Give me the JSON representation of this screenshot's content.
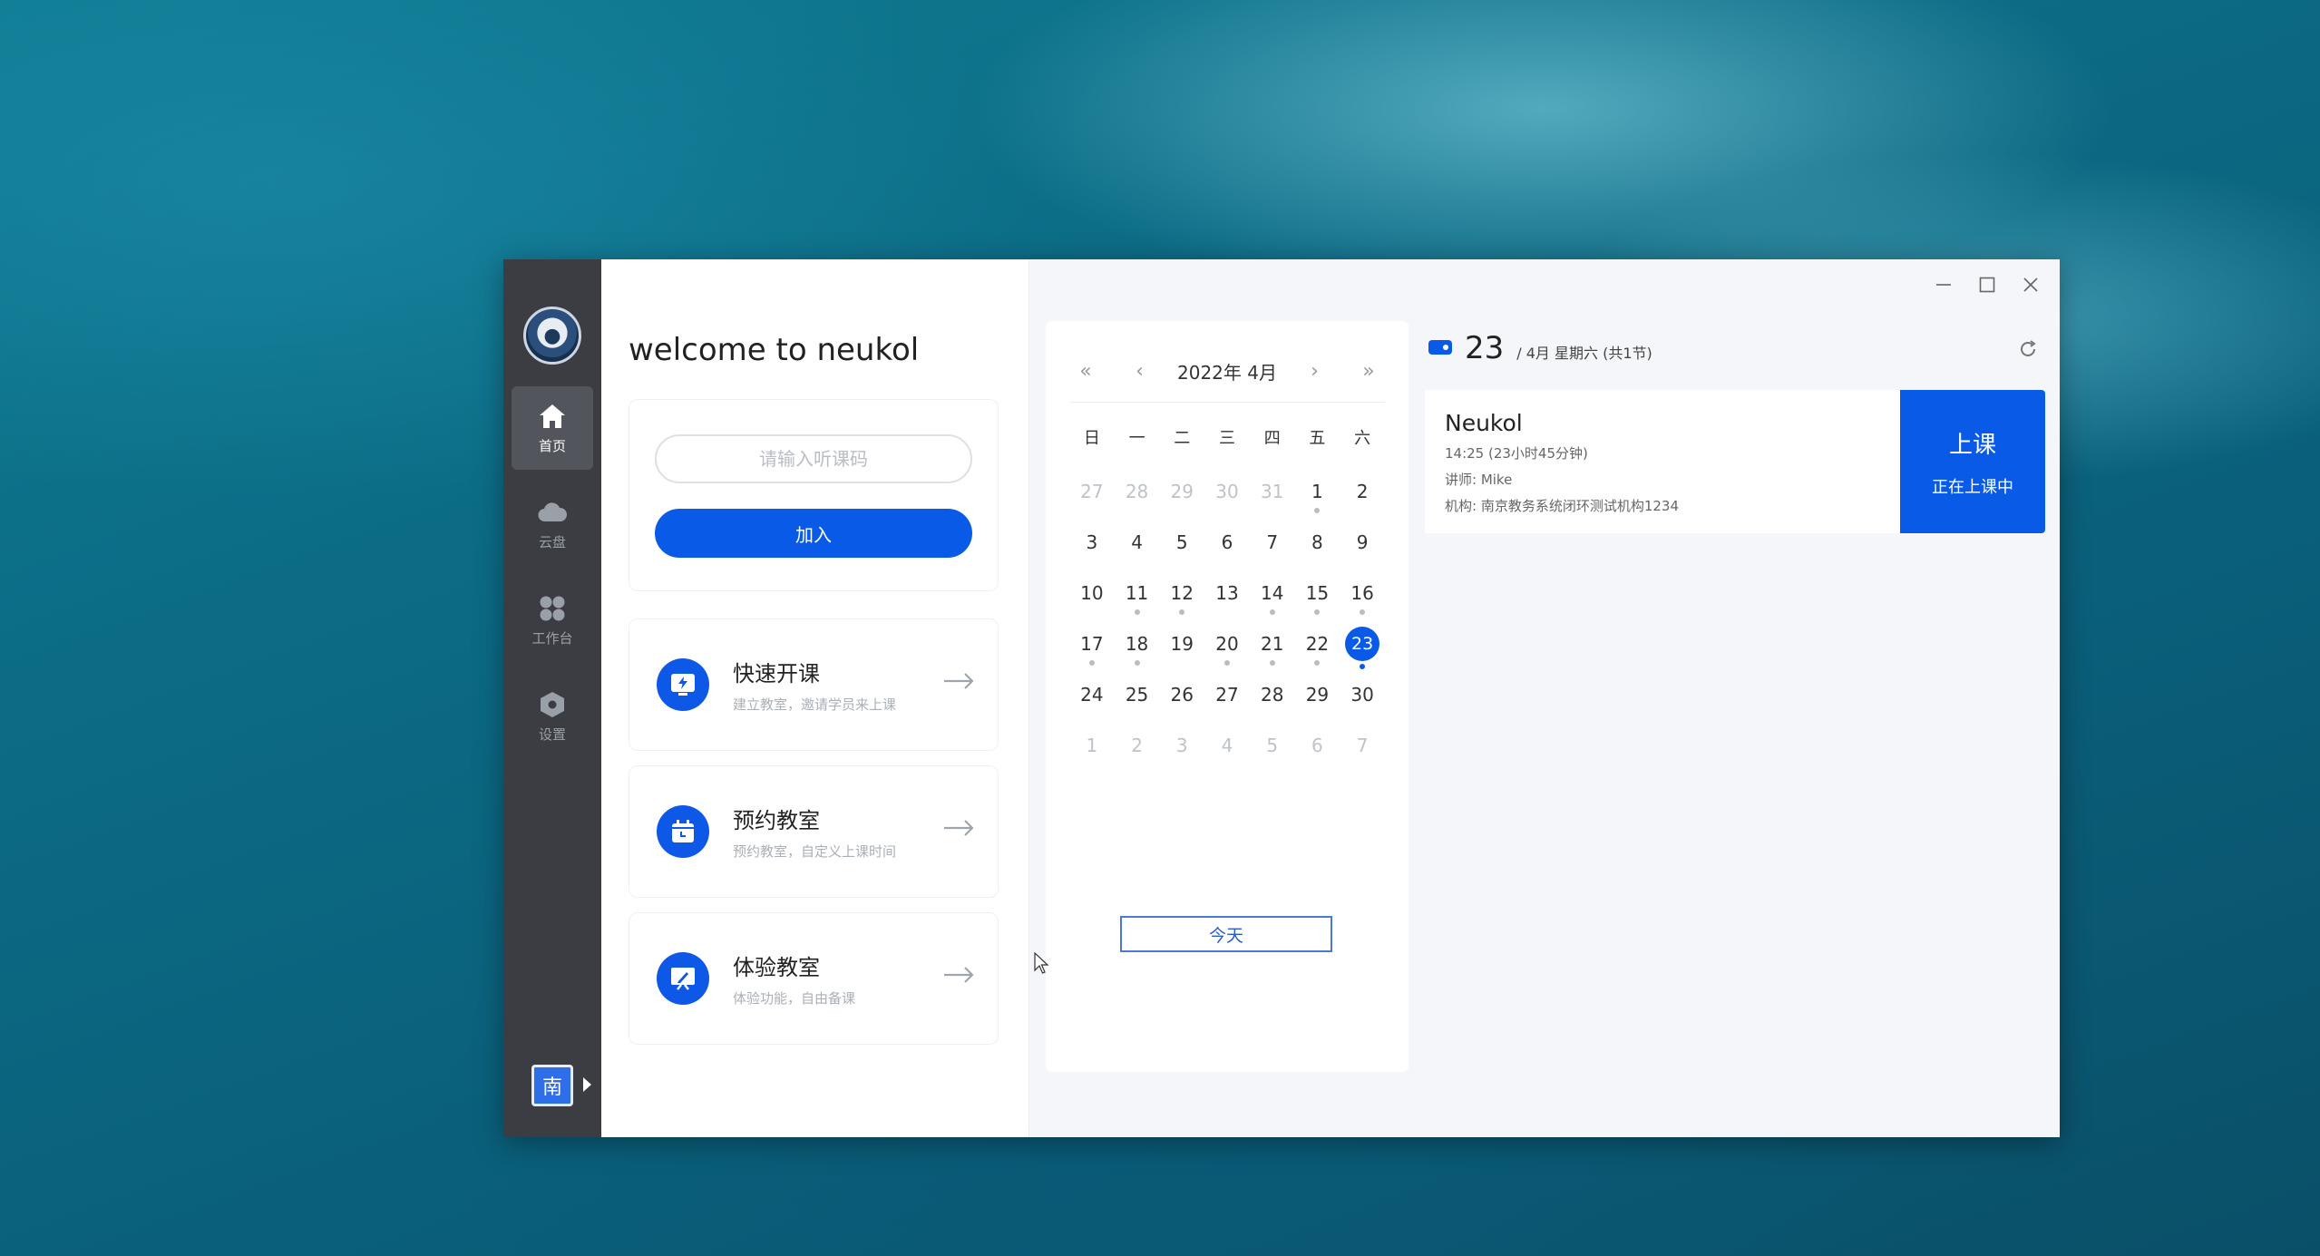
{
  "sidebar": {
    "items": [
      {
        "label": "首页",
        "icon": "home-icon",
        "active": true
      },
      {
        "label": "云盘",
        "icon": "cloud-icon",
        "active": false
      },
      {
        "label": "工作台",
        "icon": "workbench-icon",
        "active": false
      },
      {
        "label": "设置",
        "icon": "settings-icon",
        "active": false
      }
    ],
    "org_badge": "南"
  },
  "welcome": "welcome to neukol",
  "join": {
    "placeholder": "请输入听课码",
    "button": "加入"
  },
  "actions": [
    {
      "title": "快速开课",
      "subtitle": "建立教室，邀请学员来上课",
      "icon": "lightning-screen-icon"
    },
    {
      "title": "预约教室",
      "subtitle": "预约教室，自定义上课时间",
      "icon": "calendar-icon"
    },
    {
      "title": "体验教室",
      "subtitle": "体验功能，自由备课",
      "icon": "board-icon"
    }
  ],
  "calendar": {
    "prev_year": "«",
    "prev_month": "‹",
    "title": "2022年 4月",
    "next_month": "›",
    "next_year": "»",
    "weekdays": [
      "日",
      "一",
      "二",
      "三",
      "四",
      "五",
      "六"
    ],
    "weeks": [
      [
        {
          "d": "27",
          "o": true
        },
        {
          "d": "28",
          "o": true
        },
        {
          "d": "29",
          "o": true
        },
        {
          "d": "30",
          "o": true
        },
        {
          "d": "31",
          "o": true
        },
        {
          "d": "1",
          "dot": true
        },
        {
          "d": "2"
        }
      ],
      [
        {
          "d": "3"
        },
        {
          "d": "4"
        },
        {
          "d": "5"
        },
        {
          "d": "6"
        },
        {
          "d": "7"
        },
        {
          "d": "8"
        },
        {
          "d": "9"
        }
      ],
      [
        {
          "d": "10"
        },
        {
          "d": "11",
          "dot": true
        },
        {
          "d": "12",
          "dot": true
        },
        {
          "d": "13"
        },
        {
          "d": "14",
          "dot": true
        },
        {
          "d": "15",
          "dot": true
        },
        {
          "d": "16",
          "dot": true
        }
      ],
      [
        {
          "d": "17",
          "dot": true
        },
        {
          "d": "18",
          "dot": true
        },
        {
          "d": "19"
        },
        {
          "d": "20",
          "dot": true
        },
        {
          "d": "21",
          "dot": true
        },
        {
          "d": "22",
          "dot": true
        },
        {
          "d": "23",
          "today": true,
          "dot": true
        }
      ],
      [
        {
          "d": "24"
        },
        {
          "d": "25"
        },
        {
          "d": "26"
        },
        {
          "d": "27"
        },
        {
          "d": "28"
        },
        {
          "d": "29"
        },
        {
          "d": "30"
        }
      ],
      [
        {
          "d": "1",
          "o": true
        },
        {
          "d": "2",
          "o": true
        },
        {
          "d": "3",
          "o": true
        },
        {
          "d": "4",
          "o": true
        },
        {
          "d": "5",
          "o": true
        },
        {
          "d": "6",
          "o": true
        },
        {
          "d": "7",
          "o": true
        }
      ]
    ],
    "today_button": "今天"
  },
  "day_panel": {
    "day": "23",
    "meta": "/ 4月   星期六 (共1节)"
  },
  "lesson": {
    "title": "Neukol",
    "time": "14:25   (23小时45分钟)",
    "teacher": "讲师: Mike",
    "org": "机构: 南京教务系统闭环测试机构1234",
    "button_main": "上课",
    "button_sub": "正在上课中"
  },
  "colors": {
    "accent": "#0a5ae8",
    "sidebar": "#3b3d42"
  }
}
